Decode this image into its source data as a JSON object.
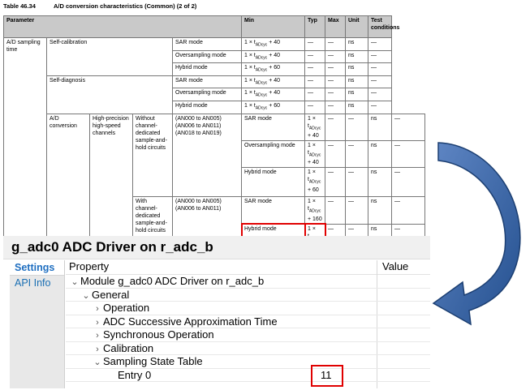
{
  "doc": {
    "table_number": "Table 46.34",
    "table_title": "A/D conversion characteristics (Common) (2 of 2)",
    "headers": {
      "parameter": "Parameter",
      "min": "Min",
      "typ": "Typ",
      "max": "Max",
      "unit": "Unit",
      "test": "Test conditions"
    },
    "group": "A/D sampling time",
    "self_cal": "Self-calibration",
    "self_diag": "Self-diagnosis",
    "ad_conv": "A/D conversion",
    "hp_channels": "High-precision high-speed channels",
    "without_ch": "Without channel-dedicated sample-and-hold circuits",
    "without_pins": "(AN000 to AN005) (AN006 to AN011) (AN018 to AN019)",
    "with_ch": "With channel-dedicated sample-and-hold circuits",
    "with_pins": "(AN000 to AN005) (AN006 to AN011)",
    "modes": {
      "sar": "SAR mode",
      "over": "Oversampling mode",
      "hybrid": "Hybrid mode"
    },
    "min_prefix": "1 × t",
    "min_sub": "ADcyc",
    "min_40": " + 40",
    "min_60": " + 60",
    "min_160": " + 160",
    "dash": "—",
    "unit": "ns"
  },
  "ide": {
    "title": "g_adc0 ADC Driver on r_adc_b",
    "tabs": [
      "Settings",
      "API Info"
    ],
    "col_property": "Property",
    "col_value": "Value",
    "tree": [
      {
        "label": "Module g_adc0 ADC Driver on r_adc_b",
        "twisty": "expanded"
      },
      {
        "label": "General",
        "twisty": "expanded"
      },
      {
        "label": "Operation",
        "twisty": "collapsed"
      },
      {
        "label": "ADC Successive Approximation Time",
        "twisty": "collapsed"
      },
      {
        "label": "Synchronous Operation",
        "twisty": "collapsed"
      },
      {
        "label": "Calibration",
        "twisty": "collapsed"
      },
      {
        "label": "Sampling State Table",
        "twisty": "expanded"
      },
      {
        "label": "Entry 0",
        "twisty": "none"
      }
    ],
    "entry0_value": "11"
  },
  "colors": {
    "highlight": "#e00000",
    "arrow": "#2f5d9c",
    "tab_active": "#1e6ec0"
  }
}
